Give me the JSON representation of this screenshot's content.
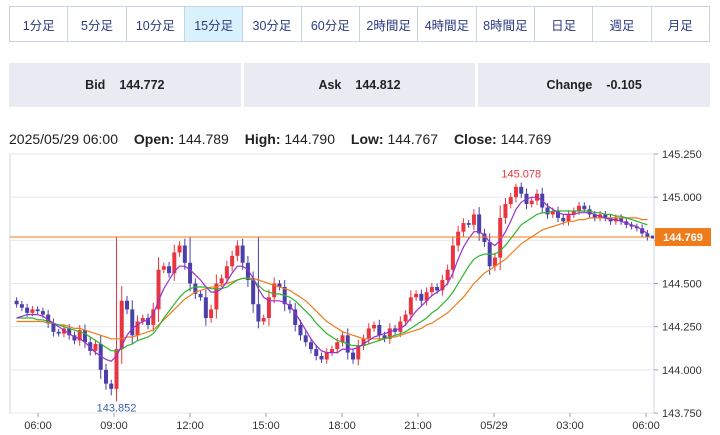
{
  "timeframes": [
    {
      "label": "1分足",
      "active": false
    },
    {
      "label": "5分足",
      "active": false
    },
    {
      "label": "10分足",
      "active": false
    },
    {
      "label": "15分足",
      "active": true
    },
    {
      "label": "30分足",
      "active": false
    },
    {
      "label": "60分足",
      "active": false
    },
    {
      "label": "2時間足",
      "active": false
    },
    {
      "label": "4時間足",
      "active": false
    },
    {
      "label": "8時間足",
      "active": false
    },
    {
      "label": "日足",
      "active": false
    },
    {
      "label": "週足",
      "active": false
    },
    {
      "label": "月足",
      "active": false
    }
  ],
  "quote": {
    "bid_label": "Bid",
    "bid": "144.772",
    "ask_label": "Ask",
    "ask": "144.812",
    "change_label": "Change",
    "change": "-0.105"
  },
  "ohlc": {
    "datetime": "2025/05/29 06:00",
    "open_label": "Open:",
    "open": "144.789",
    "high_label": "High:",
    "high": "144.790",
    "low_label": "Low:",
    "low": "144.767",
    "close_label": "Close:",
    "close": "144.769"
  },
  "colors": {
    "up": "#e8353f",
    "down": "#4b3fa8",
    "ma_short": "#9a2fd0",
    "ma_mid": "#2db52d",
    "ma_long": "#f07b1a",
    "current_price": "#f07b1a",
    "high_label": "#e8353f",
    "low_label": "#3b5fa8"
  },
  "chart_data": {
    "type": "candlestick",
    "y_ticks": [
      "145.250",
      "145.000",
      "144.750",
      "144.500",
      "144.250",
      "144.000",
      "143.750"
    ],
    "ylim": [
      143.75,
      145.25
    ],
    "x_ticks": [
      "06:00",
      "09:00",
      "12:00",
      "15:00",
      "18:00",
      "21:00",
      "05/29",
      "03:00",
      "06:00"
    ],
    "current_price": 144.769,
    "current_price_label": "144.769",
    "high_marker": {
      "value": 145.078,
      "label": "145.078"
    },
    "low_marker": {
      "value": 143.852,
      "label": "143.852"
    },
    "closes": [
      144.38,
      144.36,
      144.33,
      144.35,
      144.34,
      144.32,
      144.27,
      144.22,
      144.21,
      144.24,
      144.2,
      144.17,
      144.23,
      144.16,
      144.11,
      144.15,
      144.0,
      143.92,
      143.89,
      144.12,
      144.4,
      144.35,
      144.2,
      144.28,
      144.3,
      144.26,
      144.35,
      144.58,
      144.6,
      144.56,
      144.68,
      144.72,
      144.62,
      144.5,
      144.44,
      144.42,
      144.3,
      144.35,
      144.5,
      144.53,
      144.6,
      144.66,
      144.72,
      144.62,
      144.52,
      144.38,
      144.28,
      144.3,
      144.42,
      144.5,
      144.48,
      144.38,
      144.35,
      144.26,
      144.2,
      144.16,
      144.12,
      144.08,
      144.06,
      144.1,
      144.12,
      144.16,
      144.2,
      144.1,
      144.06,
      144.14,
      144.18,
      144.24,
      144.26,
      144.2,
      144.18,
      144.24,
      144.22,
      144.28,
      144.32,
      144.42,
      144.44,
      144.4,
      144.45,
      144.48,
      144.46,
      144.52,
      144.58,
      144.72,
      144.8,
      144.85,
      144.84,
      144.9,
      144.79,
      144.74,
      144.6,
      144.65,
      144.88,
      144.96,
      145.0,
      145.06,
      145.02,
      144.96,
      144.98,
      145.02,
      144.94,
      144.9,
      144.92,
      144.88,
      144.86,
      144.9,
      144.92,
      144.95,
      144.93,
      144.9,
      144.88,
      144.9,
      144.88,
      144.86,
      144.88,
      144.86,
      144.84,
      144.83,
      144.82,
      144.79,
      144.769
    ],
    "ma_short": [
      144.3,
      144.31,
      144.32,
      144.32,
      144.32,
      144.31,
      144.29,
      144.27,
      144.25,
      144.23,
      144.21,
      144.19,
      144.18,
      144.16,
      144.13,
      144.1,
      144.08,
      144.06,
      144.05,
      144.08,
      144.14,
      144.2,
      144.24,
      144.26,
      144.28,
      144.29,
      144.32,
      144.4,
      144.47,
      144.52,
      144.57,
      144.6,
      144.6,
      144.58,
      144.55,
      144.52,
      144.48,
      144.45,
      144.45,
      144.47,
      144.51,
      144.56,
      144.6,
      144.6,
      144.58,
      144.53,
      144.47,
      144.42,
      144.4,
      144.4,
      144.4,
      144.39,
      144.37,
      144.33,
      144.28,
      144.23,
      144.18,
      144.14,
      144.11,
      144.1,
      144.1,
      144.1,
      144.12,
      144.12,
      144.12,
      144.13,
      144.15,
      144.17,
      144.19,
      144.2,
      144.21,
      144.22,
      144.23,
      144.24,
      144.26,
      144.3,
      144.34,
      144.37,
      144.4,
      144.43,
      144.45,
      144.47,
      144.5,
      144.56,
      144.64,
      144.71,
      144.76,
      144.8,
      144.8,
      144.78,
      144.74,
      144.72,
      144.75,
      144.8,
      144.86,
      144.93,
      144.97,
      144.99,
      145.0,
      145.0,
      144.98,
      144.95,
      144.93,
      144.91,
      144.9,
      144.9,
      144.9,
      144.91,
      144.91,
      144.91,
      144.9,
      144.89,
      144.88,
      144.87,
      144.87,
      144.86,
      144.85,
      144.84,
      144.83,
      144.81,
      144.79
    ],
    "ma_mid": [
      144.3,
      144.3,
      144.3,
      144.3,
      144.29,
      144.29,
      144.28,
      144.27,
      144.26,
      144.25,
      144.24,
      144.23,
      144.22,
      144.21,
      144.19,
      144.17,
      144.15,
      144.13,
      144.11,
      144.11,
      144.12,
      144.14,
      144.15,
      144.17,
      144.18,
      144.19,
      144.21,
      144.25,
      144.3,
      144.34,
      144.38,
      144.42,
      144.45,
      144.47,
      144.48,
      144.48,
      144.48,
      144.47,
      144.47,
      144.47,
      144.48,
      144.5,
      144.52,
      144.53,
      144.53,
      144.52,
      144.49,
      144.46,
      144.45,
      144.44,
      144.44,
      144.43,
      144.42,
      144.4,
      144.37,
      144.34,
      144.31,
      144.27,
      144.24,
      144.21,
      144.19,
      144.17,
      144.16,
      144.15,
      144.14,
      144.14,
      144.14,
      144.15,
      144.16,
      144.17,
      144.18,
      144.19,
      144.2,
      144.21,
      144.22,
      144.24,
      144.26,
      144.28,
      144.3,
      144.33,
      144.35,
      144.38,
      144.41,
      144.45,
      144.5,
      144.55,
      144.6,
      144.64,
      144.66,
      144.67,
      144.67,
      144.67,
      144.69,
      144.72,
      144.76,
      144.8,
      144.84,
      144.86,
      144.88,
      144.9,
      144.91,
      144.91,
      144.92,
      144.92,
      144.92,
      144.92,
      144.92,
      144.92,
      144.92,
      144.92,
      144.91,
      144.91,
      144.9,
      144.9,
      144.89,
      144.89,
      144.88,
      144.87,
      144.86,
      144.85,
      144.84
    ],
    "ma_long": [
      144.28,
      144.28,
      144.28,
      144.28,
      144.28,
      144.28,
      144.27,
      144.27,
      144.26,
      144.26,
      144.25,
      144.24,
      144.24,
      144.23,
      144.22,
      144.21,
      144.2,
      144.19,
      144.18,
      144.18,
      144.18,
      144.19,
      144.19,
      144.2,
      144.21,
      144.22,
      144.23,
      144.26,
      144.29,
      144.32,
      144.35,
      144.38,
      144.41,
      144.43,
      144.45,
      144.46,
      144.47,
      144.48,
      144.48,
      144.49,
      144.5,
      144.51,
      144.52,
      144.53,
      144.53,
      144.53,
      144.52,
      144.51,
      144.5,
      144.49,
      144.48,
      144.47,
      144.46,
      144.44,
      144.42,
      144.4,
      144.37,
      144.34,
      144.31,
      144.28,
      144.26,
      144.24,
      144.22,
      144.21,
      144.2,
      144.19,
      144.18,
      144.18,
      144.18,
      144.18,
      144.18,
      144.19,
      144.19,
      144.2,
      144.21,
      144.22,
      144.23,
      144.24,
      144.26,
      144.27,
      144.29,
      144.31,
      144.33,
      144.36,
      144.39,
      144.42,
      144.46,
      144.5,
      144.53,
      144.56,
      144.58,
      144.6,
      144.62,
      144.64,
      144.67,
      144.7,
      144.73,
      144.75,
      144.77,
      144.79,
      144.81,
      144.82,
      144.83,
      144.84,
      144.85,
      144.86,
      144.86,
      144.87,
      144.87,
      144.88,
      144.88,
      144.88,
      144.88,
      144.88,
      144.88,
      144.88,
      144.88,
      144.88,
      144.88,
      144.87,
      144.87
    ]
  }
}
